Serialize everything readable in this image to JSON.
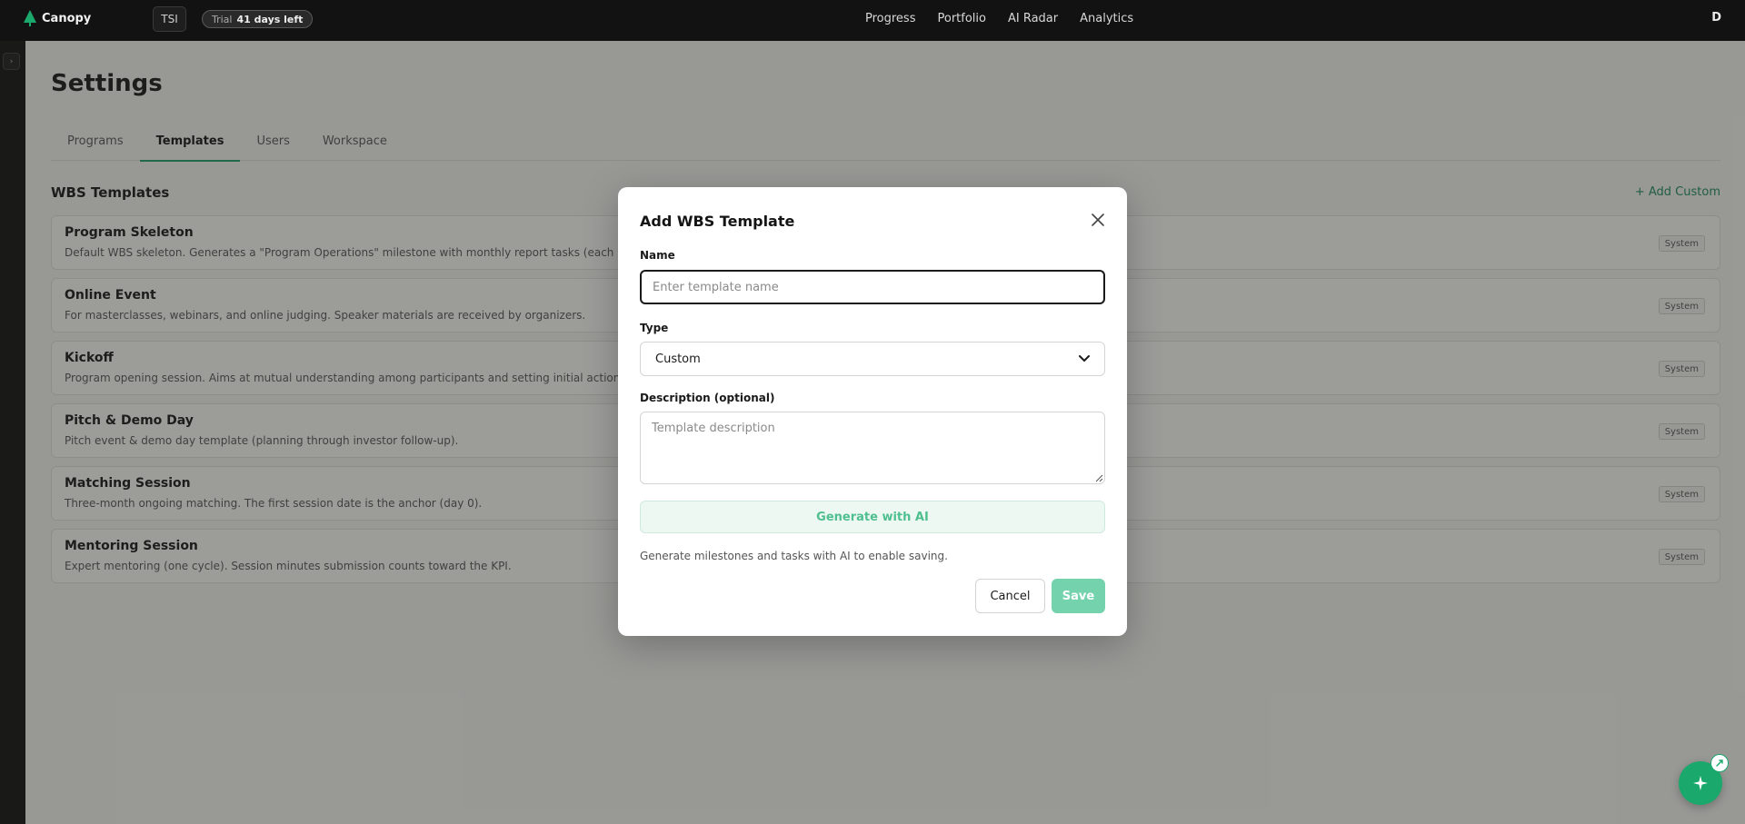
{
  "topbar": {
    "brand_name": "Canopy",
    "org_badge": "TSI",
    "trial_label": "Trial",
    "trial_days": "41 days left",
    "nav": [
      "Progress",
      "Portfolio",
      "AI Radar",
      "Analytics"
    ],
    "user_initial": "D"
  },
  "page": {
    "title": "Settings",
    "tabs": [
      "Programs",
      "Templates",
      "Users",
      "Workspace"
    ],
    "active_tab": "Templates",
    "section_title": "WBS Templates",
    "add_custom_label": "+ Add Custom"
  },
  "templates": [
    {
      "name": "Program Skeleton",
      "description": "Default WBS skeleton. Generates a \"Program Operations\" milestone with monthly report tasks (each month-end) an",
      "badge": "System"
    },
    {
      "name": "Online Event",
      "description": "For masterclasses, webinars, and online judging. Speaker materials are received by organizers.",
      "badge": "System"
    },
    {
      "name": "Kickoff",
      "description": "Program opening session. Aims at mutual understanding among participants and setting initial action items.",
      "badge": "System"
    },
    {
      "name": "Pitch & Demo Day",
      "description": "Pitch event & demo day template (planning through investor follow-up).",
      "badge": "System"
    },
    {
      "name": "Matching Session",
      "description": "Three-month ongoing matching. The first session date is the anchor (day 0).",
      "badge": "System"
    },
    {
      "name": "Mentoring Session",
      "description": "Expert mentoring (one cycle). Session minutes submission counts toward the KPI.",
      "badge": "System"
    }
  ],
  "modal": {
    "title": "Add WBS Template",
    "name_label": "Name",
    "name_value": "",
    "name_placeholder": "Enter template name",
    "type_label": "Type",
    "type_value": "Custom",
    "description_label": "Description (optional)",
    "description_value": "",
    "description_placeholder": "Template description",
    "generate_label": "Generate with AI",
    "hint": "Generate milestones and tasks with AI to enable saving.",
    "cancel_label": "Cancel",
    "save_label": "Save"
  },
  "colors": {
    "accent": "#1aa86c",
    "save_disabled": "#74d3ad",
    "generate_text": "#4fbf8f"
  },
  "icons": {
    "brand": "tree-logo-icon",
    "rail_toggle": "chevron-right-icon",
    "close": "close-icon",
    "select": "chevron-down-icon",
    "fab": "sparkle-icon",
    "fab_mini": "link-icon"
  }
}
